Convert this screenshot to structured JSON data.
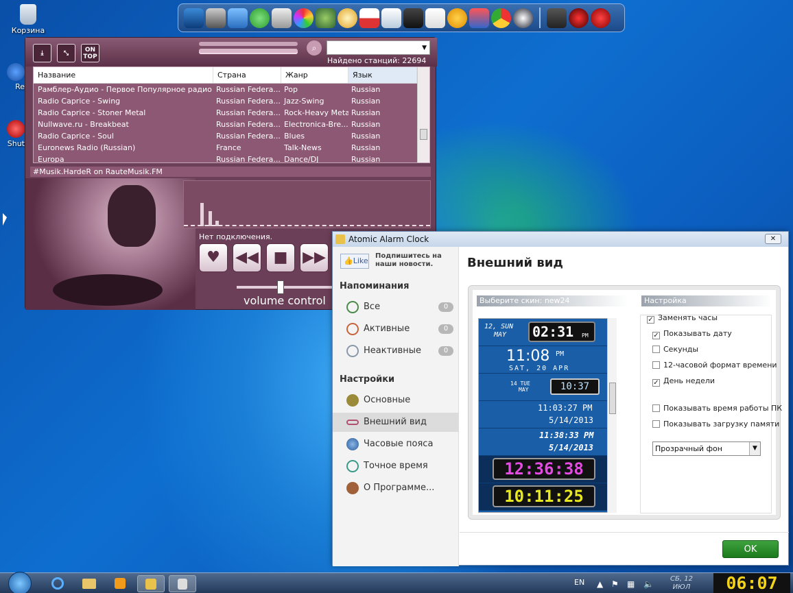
{
  "desktop": {
    "icons": [
      {
        "label": "Корзина"
      },
      {
        "label": "Re"
      },
      {
        "label": "Shut"
      }
    ]
  },
  "dock": {
    "icons": [
      "monitor-icon",
      "phone-icon",
      "network-icon",
      "skype-icon",
      "speaker-icon",
      "picasa-icon",
      "utorrent-icon",
      "clock-icon",
      "calendar-icon",
      "chart-icon",
      "video-icon",
      "fox-icon",
      "aimp-icon",
      "tools-icon",
      "chrome-icon",
      "counter-icon",
      "hat-icon",
      "gear-red-icon",
      "ccleaner-icon"
    ]
  },
  "radio": {
    "on_top": "ON TOP",
    "found": "Найдено станций: 22694",
    "columns": [
      "Название",
      "Страна",
      "Жанр",
      "Язык"
    ],
    "rows": [
      [
        "Рамблер-Аудио - Первое Популярное радио (...",
        "Russian Federa...",
        "Pop",
        "Russian"
      ],
      [
        "Radio Caprice - Swing",
        "Russian Federa...",
        "Jazz-Swing",
        "Russian"
      ],
      [
        "Radio Caprice - Stoner Metal",
        "Russian Federa...",
        "Rock-Heavy Metal",
        "Russian"
      ],
      [
        "Nullwave.ru - Breakbeat",
        "Russian Federa...",
        "Electronica-Bre...",
        "Russian"
      ],
      [
        "Radio Caprice - Soul",
        "Russian Federa...",
        "Blues",
        "Russian"
      ],
      [
        "Euronews Radio (Russian)",
        "France",
        "Talk-News",
        "Russian"
      ],
      [
        "Europa",
        "Russian Federa...",
        "Dance/DJ",
        "Russian"
      ]
    ],
    "now_playing": "#Musik.HardeR on RauteMusik.FM",
    "status": "Нет подключения.",
    "volume_label": "volume control",
    "volume_level": 0.45
  },
  "alarm": {
    "title": "Atomic Alarm Clock",
    "like": "Like",
    "subscribe": "Подпишитесь на наши новости.",
    "reminders_header": "Напоминания",
    "reminders": [
      {
        "label": "Все",
        "count": "0"
      },
      {
        "label": "Активные",
        "count": "0"
      },
      {
        "label": "Неактивные",
        "count": "0"
      }
    ],
    "settings_header": "Настройки",
    "settings": [
      {
        "label": "Основные"
      },
      {
        "label": "Внешний вид"
      },
      {
        "label": "Часовые пояса"
      },
      {
        "label": "Точное время"
      },
      {
        "label": "О Программе..."
      }
    ],
    "page_title": "Внешний вид",
    "skin_header": "Выберите скин: new24",
    "settings_panel_header": "Настройка",
    "skins": [
      {
        "line1": "12, SUN",
        "line2": "MAY",
        "time": "02:31",
        "ampm": "PM"
      },
      {
        "time": "11:08",
        "ampm": "PM",
        "line2": "SAT, 20 APR"
      },
      {
        "line1": "14 TUE",
        "line2": "MAY",
        "time": "10:37",
        "ampm": "PM"
      },
      {
        "time": "11:03:27 PM",
        "line2": "5/14/2013"
      },
      {
        "time": "11:38:33 PM",
        "line2": "5/14/2013"
      },
      {
        "time": "12:36:38",
        "ampm": "AM PM"
      },
      {
        "time": "10:11:25",
        "ampm": "AM PM"
      }
    ],
    "options": [
      {
        "label": "Заменять часы",
        "checked": true
      },
      {
        "label": "Показывать дату",
        "checked": true
      },
      {
        "label": "Секунды",
        "checked": false
      },
      {
        "label": "12-часовой формат времени",
        "checked": false
      },
      {
        "label": "День недели",
        "checked": true
      },
      {
        "label": "Показывать время работы ПК",
        "checked": false
      },
      {
        "label": "Показывать загрузку памяти",
        "checked": false
      }
    ],
    "background_select": "Прозрачный фон",
    "ok": "OK"
  },
  "taskbar": {
    "lang": "EN",
    "date_line1": "СБ, 12",
    "date_line2": "ИЮЛ",
    "clock": "06:07"
  }
}
